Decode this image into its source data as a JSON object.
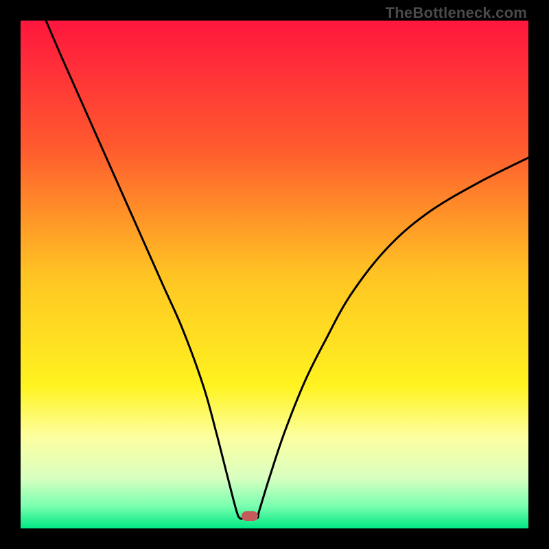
{
  "watermark": "TheBottleneck.com",
  "chart_data": {
    "type": "line",
    "title": "",
    "xlabel": "",
    "ylabel": "",
    "xlim": [
      0,
      100
    ],
    "ylim": [
      0,
      100
    ],
    "gradient_stops": [
      {
        "offset": 0.0,
        "color": "#ff163e"
      },
      {
        "offset": 0.25,
        "color": "#ff5a2e"
      },
      {
        "offset": 0.5,
        "color": "#ffc423"
      },
      {
        "offset": 0.72,
        "color": "#fff320"
      },
      {
        "offset": 0.82,
        "color": "#fdffa0"
      },
      {
        "offset": 0.9,
        "color": "#d9ffc0"
      },
      {
        "offset": 0.955,
        "color": "#7cffb0"
      },
      {
        "offset": 1.0,
        "color": "#00e884"
      }
    ],
    "series": [
      {
        "name": "bottleneck-curve",
        "x": [
          5,
          8,
          12,
          16,
          20,
          24,
          28,
          32,
          36,
          38.5,
          40.8,
          42.5,
          43.2,
          44.0,
          46.5,
          47.0,
          49.0,
          52.0,
          56.0,
          60.0,
          65.0,
          72.0,
          80.0,
          90.0,
          100.0
        ],
        "y": [
          100,
          93,
          84,
          75,
          66,
          57,
          48,
          39,
          28,
          19,
          10,
          3.5,
          2.0,
          2.0,
          2.0,
          3.5,
          10,
          19,
          29,
          37,
          46,
          55,
          62,
          68,
          73
        ]
      }
    ],
    "marker": {
      "x": 45.2,
      "y": 2.4
    },
    "flat_bottom": {
      "x_start": 43.2,
      "x_end": 46.8,
      "y": 2.0
    }
  }
}
